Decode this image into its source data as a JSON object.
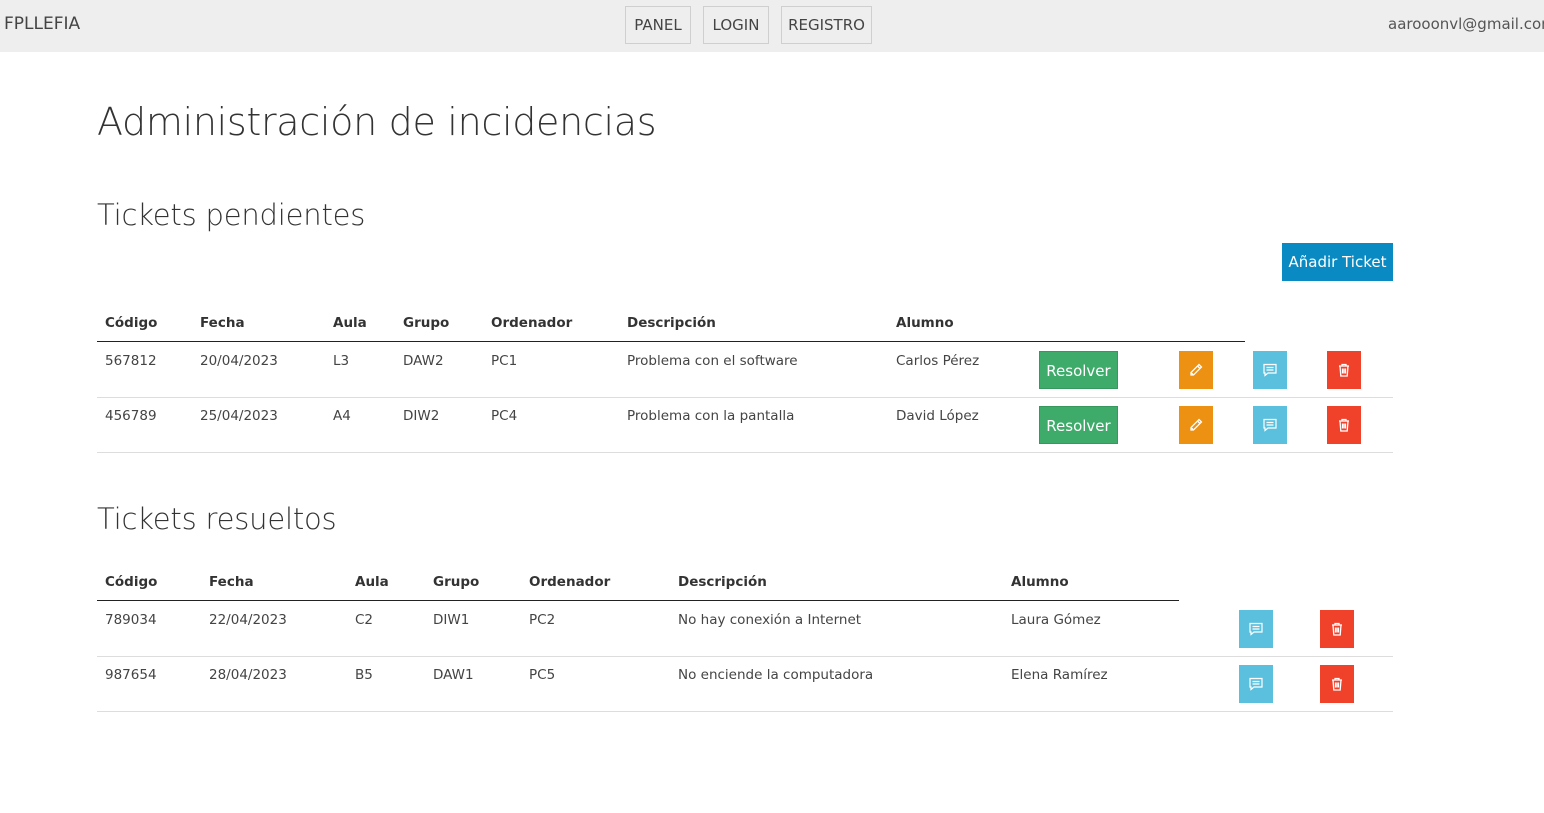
{
  "navbar": {
    "brand": "FPLLEFIA",
    "links": [
      "PANEL",
      "LOGIN",
      "REGISTRO"
    ],
    "user_email": "aarooonvl@gmail.com"
  },
  "page_title": "Administración de incidencias",
  "pending": {
    "title": "Tickets pendientes",
    "add_button": "Añadir Ticket",
    "columns": [
      "Código",
      "Fecha",
      "Aula",
      "Grupo",
      "Ordenador",
      "Descripción",
      "Alumno"
    ],
    "resolve_label": "Resolver",
    "rows": [
      [
        "567812",
        "20/04/2023",
        "L3",
        "DAW2",
        "PC1",
        "Problema con el software",
        "Carlos Pérez"
      ],
      [
        "456789",
        "25/04/2023",
        "A4",
        "DIW2",
        "PC4",
        "Problema con la pantalla",
        "David López"
      ]
    ]
  },
  "resolved": {
    "title": "Tickets resueltos",
    "columns": [
      "Código",
      "Fecha",
      "Aula",
      "Grupo",
      "Ordenador",
      "Descripción",
      "Alumno"
    ],
    "rows": [
      [
        "789034",
        "22/04/2023",
        "C2",
        "DIW1",
        "PC2",
        "No hay conexión a Internet",
        "Laura Gómez"
      ],
      [
        "987654",
        "28/04/2023",
        "B5",
        "DAW1",
        "PC5",
        "No enciende la computadora",
        "Elena Ramírez"
      ]
    ]
  },
  "colors": {
    "resolve": "#3fab6b",
    "edit": "#ed9112",
    "comment": "#5bc0de",
    "delete": "#f0412b",
    "add": "#0a8ac2"
  },
  "icons": {
    "edit": "pencil-icon",
    "comment": "comment-icon",
    "delete": "trash-icon"
  }
}
